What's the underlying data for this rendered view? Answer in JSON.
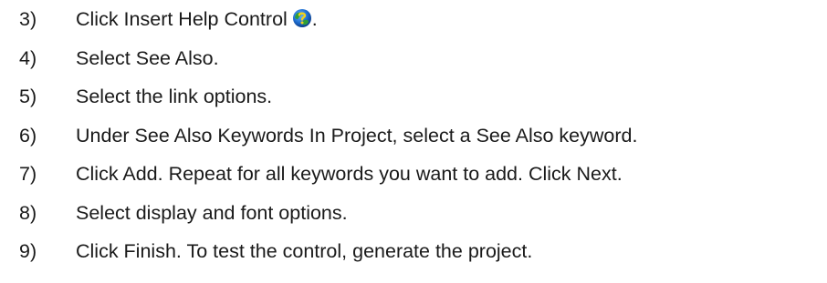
{
  "steps": [
    {
      "number": "3)",
      "text": "Click Insert Help Control",
      "icon": "help-control-globe-icon",
      "suffix": "."
    },
    {
      "number": "4)",
      "text": "Select See Also."
    },
    {
      "number": "5)",
      "text": "Select the link options."
    },
    {
      "number": "6)",
      "text": "Under See Also Keywords In Project, select a See Also keyword."
    },
    {
      "number": "7)",
      "text": "Click Add. Repeat for all keywords you want to add. Click Next."
    },
    {
      "number": "8)",
      "text": "Select display and font options."
    },
    {
      "number": "9)",
      "text": "Click Finish. To test the control, generate the project."
    }
  ],
  "colors": {
    "text": "#1a1a1a",
    "icon_blue": "#1f6fd1",
    "icon_green": "#2e9e3a",
    "icon_yellow": "#f2d21b"
  }
}
